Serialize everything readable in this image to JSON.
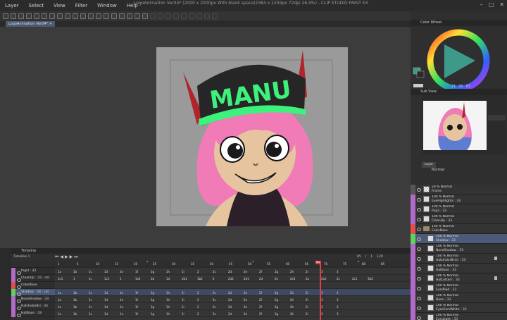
{
  "menu": [
    "Layer",
    "Select",
    "View",
    "Filter",
    "Window",
    "Help"
  ],
  "app_title": "LogoAnimation Ver04* (2000 x 2000px With blank space(2384 x 2259px 72dpi 26.9%) - CLIP STUDIO PAINT EX",
  "doc_tab": "LogoAnimation Ver04*",
  "artwork": {
    "hat_text": "MANU"
  },
  "panels": {
    "color_wheel": "Color Wheel",
    "color_values": {
      "h": "21",
      "s": "95",
      "v": "83"
    },
    "sub_view": "Sub View",
    "layer_tab": "Layer",
    "blend_mode": "Normal"
  },
  "layers": [
    {
      "l1": "20 % Normal",
      "l2": "Frame",
      "strip": "#555",
      "thumb": "checker",
      "indent": 0
    },
    {
      "l1": "100 % Normal",
      "l2": "EyeHighlights : 33",
      "strip": "#b06ac8",
      "thumb": "white",
      "indent": 0
    },
    {
      "l1": "100 % Normal",
      "l2": "Pupil : 33",
      "strip": "#b06ac8",
      "thumb": "white",
      "indent": 0
    },
    {
      "l1": "100 % Normal",
      "l2": "CleanUp : 33",
      "strip": "#b06ac8",
      "thumb": "white",
      "indent": 0
    },
    {
      "l1": "100 % Normal",
      "l2": "ColorBase",
      "strip": "#e05050",
      "thumb": "folder",
      "indent": 0
    },
    {
      "l1": "100 % Normal",
      "l2": "Shadow : 33",
      "strip": "#60d060",
      "thumb": "white",
      "indent": 1,
      "sel": true
    },
    {
      "l1": "100 % Normal",
      "l2": "NoseShadow : 33",
      "strip": "#b06ac8",
      "thumb": "white",
      "indent": 1
    },
    {
      "l1": "100 % Normal",
      "l2": "HatUnderBrim : 33",
      "strip": "#b06ac8",
      "thumb": "white",
      "indent": 1,
      "lock": true
    },
    {
      "l1": "100 % Normal",
      "l2": "HatBase : 33",
      "strip": "#b06ac8",
      "thumb": "white",
      "indent": 1
    },
    {
      "l1": "100 % Normal",
      "l2": "HatLetters : 33",
      "strip": "#b06ac8",
      "thumb": "white",
      "indent": 1,
      "lock": true
    },
    {
      "l1": "100 % Normal",
      "l2": "EarsPied : 33",
      "strip": "#b06ac8",
      "thumb": "white",
      "indent": 1
    },
    {
      "l1": "100 % Normal",
      "l2": "Base : 33",
      "strip": "#b06ac8",
      "thumb": "white",
      "indent": 1
    },
    {
      "l1": "100 % Normal",
      "l2": "EyesEarsWhite : 33",
      "strip": "#b06ac8",
      "thumb": "white",
      "indent": 1
    },
    {
      "l1": "100 % Normal",
      "l2": "EarsLight : 33",
      "strip": "#b06ac8",
      "thumb": "white",
      "indent": 1
    }
  ],
  "timeline": {
    "title": "Timeline",
    "name": "Timeline 1",
    "current_frame": "65",
    "playback": {
      "start": "65",
      "sep": "/",
      "one": "1",
      "end": "120"
    },
    "ruler_top": [
      "2",
      "3",
      "4"
    ],
    "ruler": [
      "1",
      "5",
      "10",
      "15",
      "20",
      "25",
      "30",
      "35",
      "40",
      "45",
      "50",
      "55",
      "60",
      "65",
      "70",
      "75",
      "80",
      "85"
    ],
    "rows": [
      {
        "name": "Pupil : 33",
        "strip": "#b06ac8",
        "cells": [
          "1a",
          "1b",
          "1c",
          "1d",
          "1e",
          "1f",
          "1g",
          "1h",
          "1i",
          "2",
          "2c",
          "2d",
          "2e",
          "2f",
          "2g",
          "2h",
          "2i",
          "3",
          "3"
        ]
      },
      {
        "name": "CleanUp : 33 : cel",
        "strip": "#b06ac8",
        "cells": [
          "1c1",
          "1",
          "1c",
          "1c1",
          "1",
          "1e2",
          "1b",
          "1d",
          "1b1",
          "1b2",
          "2",
          "2d2",
          "2d1",
          "2d",
          "2e",
          "2e1",
          "2a",
          "2e2",
          "2c",
          "2c1",
          "3b2"
        ]
      },
      {
        "name": "ColorBase",
        "strip": "#e05050",
        "folder": true,
        "cells": []
      },
      {
        "name": "Shadow : 33 : cel",
        "strip": "#60d060",
        "sel": true,
        "cells": [
          "1a",
          "1b",
          "1c",
          "1d",
          "1e",
          "1f",
          "1g",
          "1h",
          "1i",
          "2",
          "2c",
          "2d",
          "2e",
          "2f",
          "2g",
          "2h",
          "2i",
          "3",
          "3"
        ]
      },
      {
        "name": "NoseShadow : 33",
        "strip": "#b06ac8",
        "cells": [
          "1a",
          "1b",
          "1c",
          "1d",
          "1e",
          "1f",
          "1g",
          "1h",
          "1i",
          "2",
          "2c",
          "2d",
          "2e",
          "2f",
          "2g",
          "2h",
          "2i",
          "3",
          "3"
        ]
      },
      {
        "name": "HatUnderBri : 33",
        "strip": "#b06ac8",
        "cells": [
          "1a",
          "1b",
          "1c",
          "1d",
          "1e",
          "1f",
          "1g",
          "1h",
          "1i",
          "2",
          "2c",
          "2d",
          "2e",
          "2f",
          "2g",
          "2h",
          "2i",
          "3",
          "3"
        ]
      },
      {
        "name": "HatBase : 33",
        "strip": "#b06ac8",
        "cells": [
          "1a",
          "1b",
          "1c",
          "1d",
          "1e",
          "1f",
          "1g",
          "1h",
          "1i",
          "2",
          "2c",
          "2d",
          "2e",
          "2f",
          "2g",
          "2h",
          "2i",
          "3",
          "3"
        ]
      }
    ]
  },
  "colors": {
    "accent": "#4a5a78",
    "playhead": "#e04040",
    "hat_text": "#3df27a"
  }
}
